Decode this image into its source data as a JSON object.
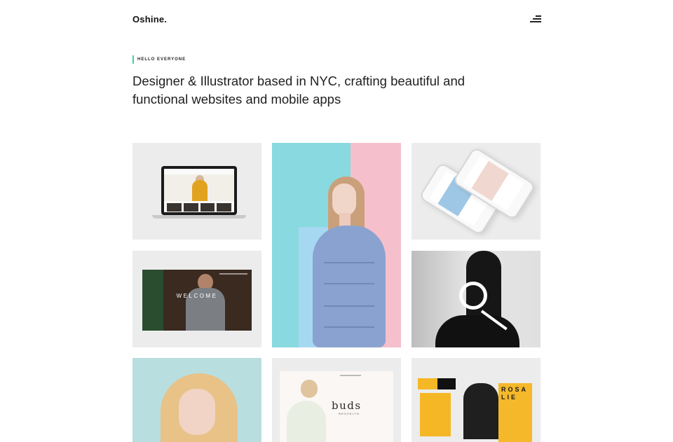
{
  "header": {
    "logo": "Oshine.",
    "menu_icon": "hamburger-menu-icon"
  },
  "intro": {
    "eyebrow": "HELLO EVERYONE",
    "headline": "Designer & Illustrator based in NYC, crafting beautiful and functional websites and mobile apps",
    "accent_color": "#3bd69b"
  },
  "portfolio": {
    "tiles": [
      {
        "id": "laptop-website-mockup"
      },
      {
        "id": "fashion-portrait-pink-cyan"
      },
      {
        "id": "iphone-app-mockup"
      },
      {
        "id": "welcome-website-mockup",
        "text": "WELCOME"
      },
      {
        "id": "q-monochrome-portrait"
      },
      {
        "id": "blonde-portrait"
      },
      {
        "id": "buds-website-mockup",
        "text": "buds",
        "subtext": "BROOKLYN"
      },
      {
        "id": "yellow-brand-identity",
        "text": "ROSALIE"
      }
    ]
  }
}
